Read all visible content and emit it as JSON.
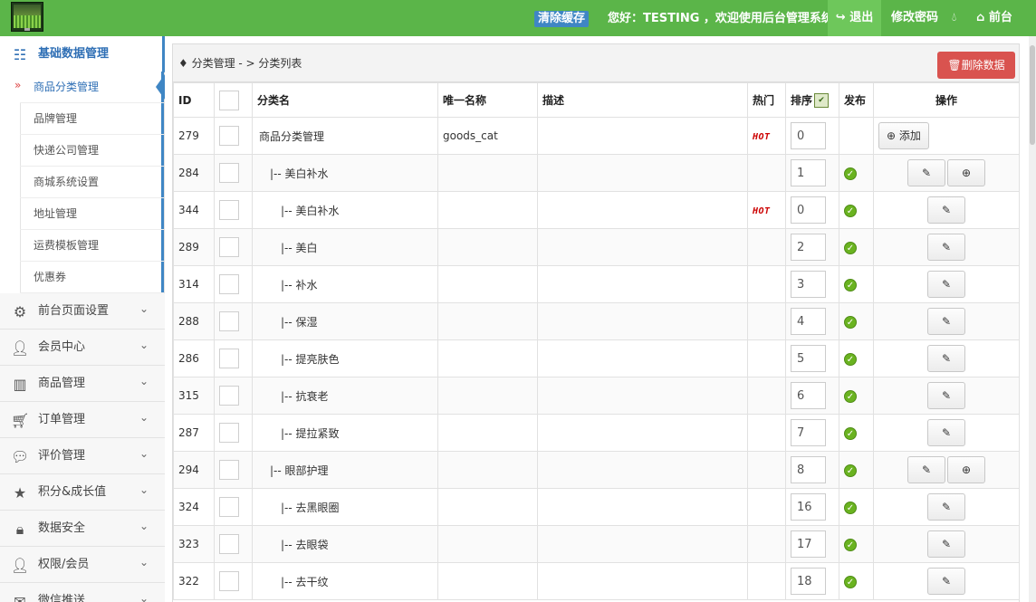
{
  "topbar": {
    "clear_cache": "清除缓存",
    "welcome": "您好：TESTING ，欢迎使用后台管理系统！",
    "logout": "退出",
    "change_password": "修改密码",
    "front": "前台"
  },
  "sidebar": {
    "active_section": "基础数据管理",
    "sub_items": [
      "商品分类管理",
      "品牌管理",
      "快递公司管理",
      "商城系统设置",
      "地址管理",
      "运费模板管理",
      "优惠券"
    ],
    "sections": [
      "前台页面设置",
      "会员中心",
      "商品管理",
      "订单管理",
      "评价管理",
      "积分&成长值",
      "数据安全",
      "权限/会员",
      "微信推送"
    ]
  },
  "breadcrumb": {
    "text": "分类管理 - > 分类列表"
  },
  "delete_button": "删除数据",
  "table": {
    "headers": {
      "id": "ID",
      "name": "分类名",
      "unique": "唯一名称",
      "desc": "描述",
      "hot": "热门",
      "sort": "排序",
      "publish": "发布",
      "ops": "操作"
    },
    "add_label": "添加",
    "hot_label": "HOT",
    "rows": [
      {
        "id": "279",
        "name": "商品分类管理",
        "unique": "goods_cat",
        "hot": true,
        "sort": "0",
        "publish": false,
        "ops": "add"
      },
      {
        "id": "284",
        "name": "|-- 美白补水",
        "unique": "",
        "hot": false,
        "sort": "1",
        "publish": true,
        "ops": "edit-plus"
      },
      {
        "id": "344",
        "name": "|-- 美白补水",
        "unique": "",
        "hot": true,
        "sort": "0",
        "publish": true,
        "ops": "edit"
      },
      {
        "id": "289",
        "name": "|-- 美白",
        "unique": "",
        "hot": false,
        "sort": "2",
        "publish": true,
        "ops": "edit"
      },
      {
        "id": "314",
        "name": "|-- 补水",
        "unique": "",
        "hot": false,
        "sort": "3",
        "publish": true,
        "ops": "edit"
      },
      {
        "id": "288",
        "name": "|-- 保湿",
        "unique": "",
        "hot": false,
        "sort": "4",
        "publish": true,
        "ops": "edit"
      },
      {
        "id": "286",
        "name": "|-- 提亮肤色",
        "unique": "",
        "hot": false,
        "sort": "5",
        "publish": true,
        "ops": "edit"
      },
      {
        "id": "315",
        "name": "|-- 抗衰老",
        "unique": "",
        "hot": false,
        "sort": "6",
        "publish": true,
        "ops": "edit"
      },
      {
        "id": "287",
        "name": "|-- 提拉紧致",
        "unique": "",
        "hot": false,
        "sort": "7",
        "publish": true,
        "ops": "edit"
      },
      {
        "id": "294",
        "name": "|-- 眼部护理",
        "unique": "",
        "hot": false,
        "sort": "8",
        "publish": true,
        "ops": "edit-plus"
      },
      {
        "id": "324",
        "name": "|-- 去黑眼圈",
        "unique": "",
        "hot": false,
        "sort": "16",
        "publish": true,
        "ops": "edit"
      },
      {
        "id": "323",
        "name": "|-- 去眼袋",
        "unique": "",
        "hot": false,
        "sort": "17",
        "publish": true,
        "ops": "edit"
      },
      {
        "id": "322",
        "name": "|-- 去干纹",
        "unique": "",
        "hot": false,
        "sort": "18",
        "publish": true,
        "ops": "edit"
      }
    ]
  }
}
